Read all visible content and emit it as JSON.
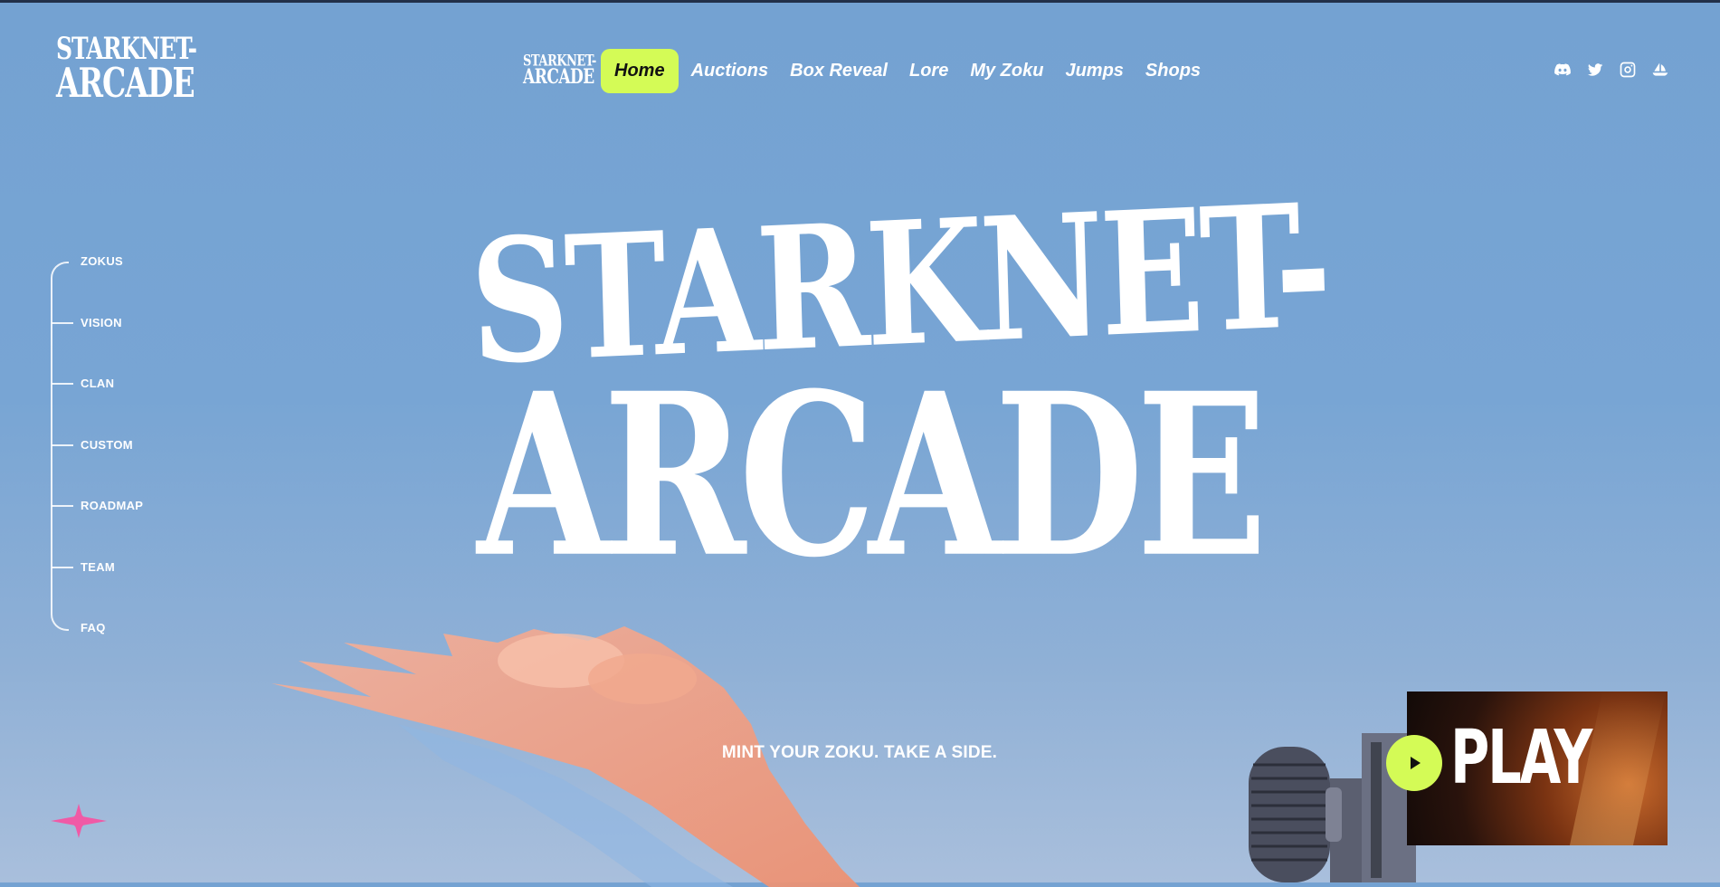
{
  "header": {
    "logo": {
      "line1": "STARKNET-",
      "line2": "ARCADE"
    },
    "nav_logo": {
      "line1": "STARKNET-",
      "line2": "ARCADE"
    },
    "nav": [
      {
        "label": "Home",
        "active": true
      },
      {
        "label": "Auctions"
      },
      {
        "label": "Box Reveal"
      },
      {
        "label": "Lore"
      },
      {
        "label": "My Zoku"
      },
      {
        "label": "Jumps"
      },
      {
        "label": "Shops"
      }
    ],
    "socials": [
      "discord-icon",
      "twitter-icon",
      "instagram-icon",
      "opensea-icon"
    ],
    "accent": "#d4fb56"
  },
  "side_nav": {
    "items": [
      "ZOKUS",
      "VISION",
      "CLAN",
      "CUSTOM",
      "ROADMAP",
      "TEAM",
      "FAQ"
    ]
  },
  "hero": {
    "title_line1": "STARKNET-",
    "title_line2": "ARCADE",
    "tagline": "MINT YOUR ZOKU. TAKE A SIDE."
  },
  "play_card": {
    "label": "PLAY",
    "button_icon": "play-icon"
  },
  "decor": {
    "sparkle_icon": "star-icon",
    "sparkle_color": "#f05aa6"
  }
}
